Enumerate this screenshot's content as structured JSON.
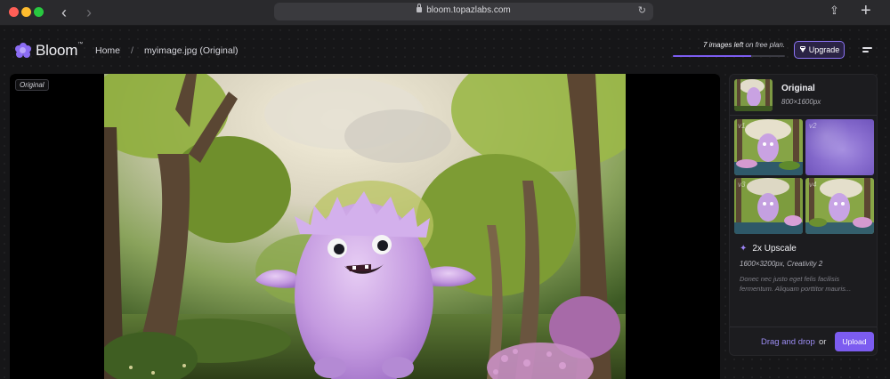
{
  "browser": {
    "url": "bloom.topazlabs.com"
  },
  "header": {
    "logo_name": "Bloom",
    "logo_tm": "™",
    "breadcrumb": [
      "Home",
      "/",
      "myimage.jpg (Original)"
    ],
    "quota_count": "7 images left",
    "quota_suffix": " on free plan.",
    "quota_fraction": 0.7,
    "upgrade_label": "Upgrade"
  },
  "viewer": {
    "badge": "Original"
  },
  "panel": {
    "original_title": "Original",
    "original_size": "800×1600px",
    "variants": [
      "v1",
      "v2",
      "v3",
      "v4"
    ],
    "upscale_title": "2x Upscale",
    "upscale_meta": "1600×3200px, Creativity 2",
    "upscale_desc": "Donec nec justo eget felis facilisis fermentum. Aliquam porttitor mauris...",
    "drag_text": "Drag and drop",
    "or_text": "or",
    "upload_label": "Upload"
  },
  "colors": {
    "accent": "#7c5cf0",
    "chrome": "#2a2a2d",
    "background": "#161618",
    "monster": "#c8a4e6"
  },
  "icons": [
    "back-arrow-icon",
    "forward-arrow-icon",
    "lock-icon",
    "reload-icon",
    "share-icon",
    "new-tab-icon",
    "bloom-flower-icon",
    "diamond-icon",
    "menu-icon",
    "sparkle-icon"
  ]
}
